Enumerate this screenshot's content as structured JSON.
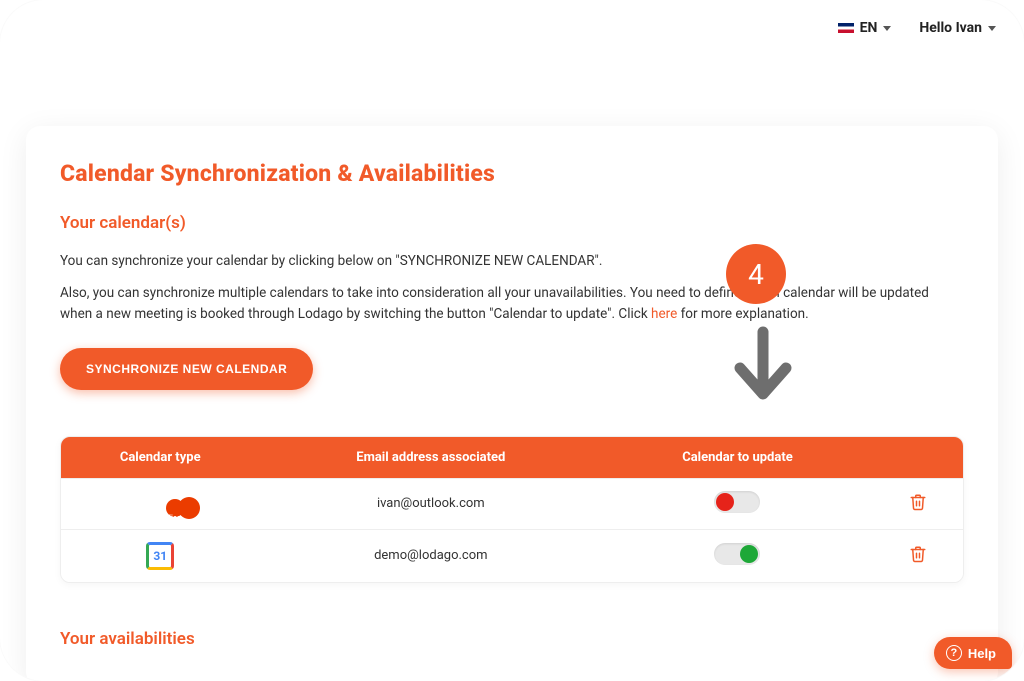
{
  "topbar": {
    "lang_label": "EN",
    "user_greeting": "Hello Ivan"
  },
  "page": {
    "title": "Calendar Synchronization & Availabilities",
    "section_calendars": "Your calendar(s)",
    "desc1": "You can synchronize your calendar by clicking below on \"SYNCHRONIZE NEW CALENDAR\".",
    "desc2_a": "Also, you can synchronize multiple calendars to take into consideration all your unavailabilities. You need to define which calendar will be updated when a new meeting is booked through Lodago by switching the button \"Calendar to update\". Click ",
    "desc2_link": "here",
    "desc2_b": " for more explanation.",
    "sync_button": "SYNCHRONIZE NEW CALENDAR",
    "section_avail": "Your availabilities"
  },
  "table": {
    "headers": {
      "type": "Calendar type",
      "email": "Email address associated",
      "update": "Calendar to update",
      "action": ""
    },
    "rows": [
      {
        "provider": "office365",
        "provider_label": "Office 365",
        "email": "ivan@outlook.com",
        "to_update": false
      },
      {
        "provider": "google",
        "provider_label": "31",
        "email": "demo@lodago.com",
        "to_update": true
      }
    ]
  },
  "overlay": {
    "step_number": "4"
  },
  "help": {
    "label": "Help"
  }
}
